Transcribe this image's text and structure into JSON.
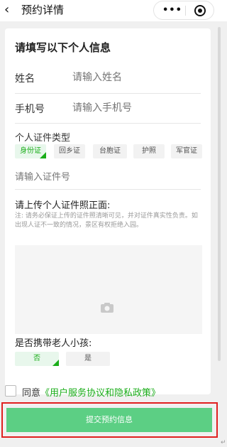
{
  "navbar": {
    "back_icon": "chevron-left-icon",
    "title": "预约详情",
    "more_icon": "more-dots-icon",
    "target_icon": "target-circle-icon"
  },
  "form": {
    "section_title": "请填写以下个人信息",
    "name": {
      "label": "姓名",
      "placeholder": "请输入姓名"
    },
    "phone": {
      "label": "手机号",
      "placeholder": "请输入手机号"
    },
    "id_type": {
      "label": "个人证件类型",
      "options": [
        "身份证",
        "回乡证",
        "台胞证",
        "护照",
        "军官证"
      ],
      "selected": "身份证"
    },
    "id_number": {
      "placeholder": "请输入证件号"
    },
    "upload": {
      "title": "请上传个人证件照正面:",
      "note": "注: 请务必保证上传的证件照清晰可见，并对证件真实性负责。如出现人证不一致的情况，景区有权拒绝入园。",
      "icon": "camera-icon"
    },
    "carry": {
      "label": "是否携带老人小孩:",
      "options": [
        "否",
        "是"
      ],
      "selected": "否"
    }
  },
  "agreement": {
    "prefix": "同意",
    "link": "《用户服务协议和隐私政策》"
  },
  "submit": {
    "label": "提交预约信息"
  },
  "colors": {
    "accent": "#1aad19",
    "button": "#5ccf84",
    "highlight_border": "#e02020"
  }
}
